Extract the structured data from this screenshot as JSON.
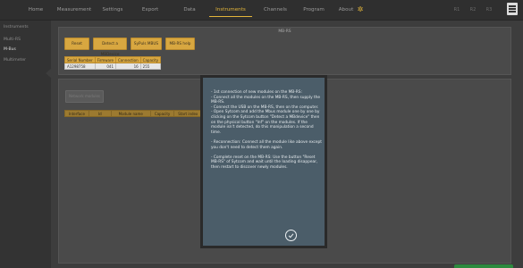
{
  "nav": {
    "items": [
      {
        "label": "Home"
      },
      {
        "label": "Measurement"
      },
      {
        "label": "Settings"
      },
      {
        "label": "Export"
      },
      {
        "label": "Data"
      },
      {
        "label": "Instruments"
      },
      {
        "label": "Channels"
      },
      {
        "label": "Program"
      },
      {
        "label": "About"
      }
    ],
    "active": "Instruments",
    "channel_buttons": [
      {
        "label": "R1"
      },
      {
        "label": "R2"
      },
      {
        "label": "R3"
      }
    ],
    "accent_color": "#e2b53a"
  },
  "sidebar": {
    "items": [
      {
        "label": "Instruments"
      },
      {
        "label": "Multi-RS"
      },
      {
        "label": "M-Bus"
      },
      {
        "label": "Multimeter"
      }
    ],
    "active": "M-Bus"
  },
  "top_panel": {
    "title": "MB-RS",
    "buttons": [
      {
        "label": "Reset"
      },
      {
        "label": "Detect a MBDevice"
      },
      {
        "label": "SyPuls MBUS"
      },
      {
        "label": "MB-RS help"
      }
    ],
    "table": {
      "headers": [
        "Serial Number",
        "Firmware",
        "Connection",
        "Capacity"
      ],
      "rows": [
        [
          "A1298758",
          "041",
          "16",
          "255"
        ]
      ]
    }
  },
  "bottom_panel": {
    "button": "Network modules",
    "table": {
      "headers": [
        "Interface",
        "Id",
        "Module name",
        "Capacity",
        "Start index"
      ]
    }
  },
  "dialog": {
    "paragraphs": [
      "- 1st connection of new modules on the MB-RS:",
      "- Connect all the modules on the MB-RS, then supply the MB-RS.",
      "- Connect the USB on the MB-RS, then on the computer.",
      "- Open Sytcom and add the Mbus module one by one by clicking on the Sytcom button \"Detect a MBdevice\" then on the physical button \"Inf\" on the modules. If the module isn't detected, do this manipulation a second time.",
      "- Reconnection: Connect all the module like above except you don't need to detect them again.",
      "- Complete reset on the MB-RS: Use the button \"Reset MB-RS\" of Sytcom and wait until the loading disappear, then restart to discover newly modules."
    ],
    "ok_icon": "check-circle-icon"
  },
  "colors": {
    "background": "#3d3d3d",
    "button_gold": "#d8a740",
    "dialog_bg": "#4b5d69",
    "status_green": "#2d8a3e"
  }
}
